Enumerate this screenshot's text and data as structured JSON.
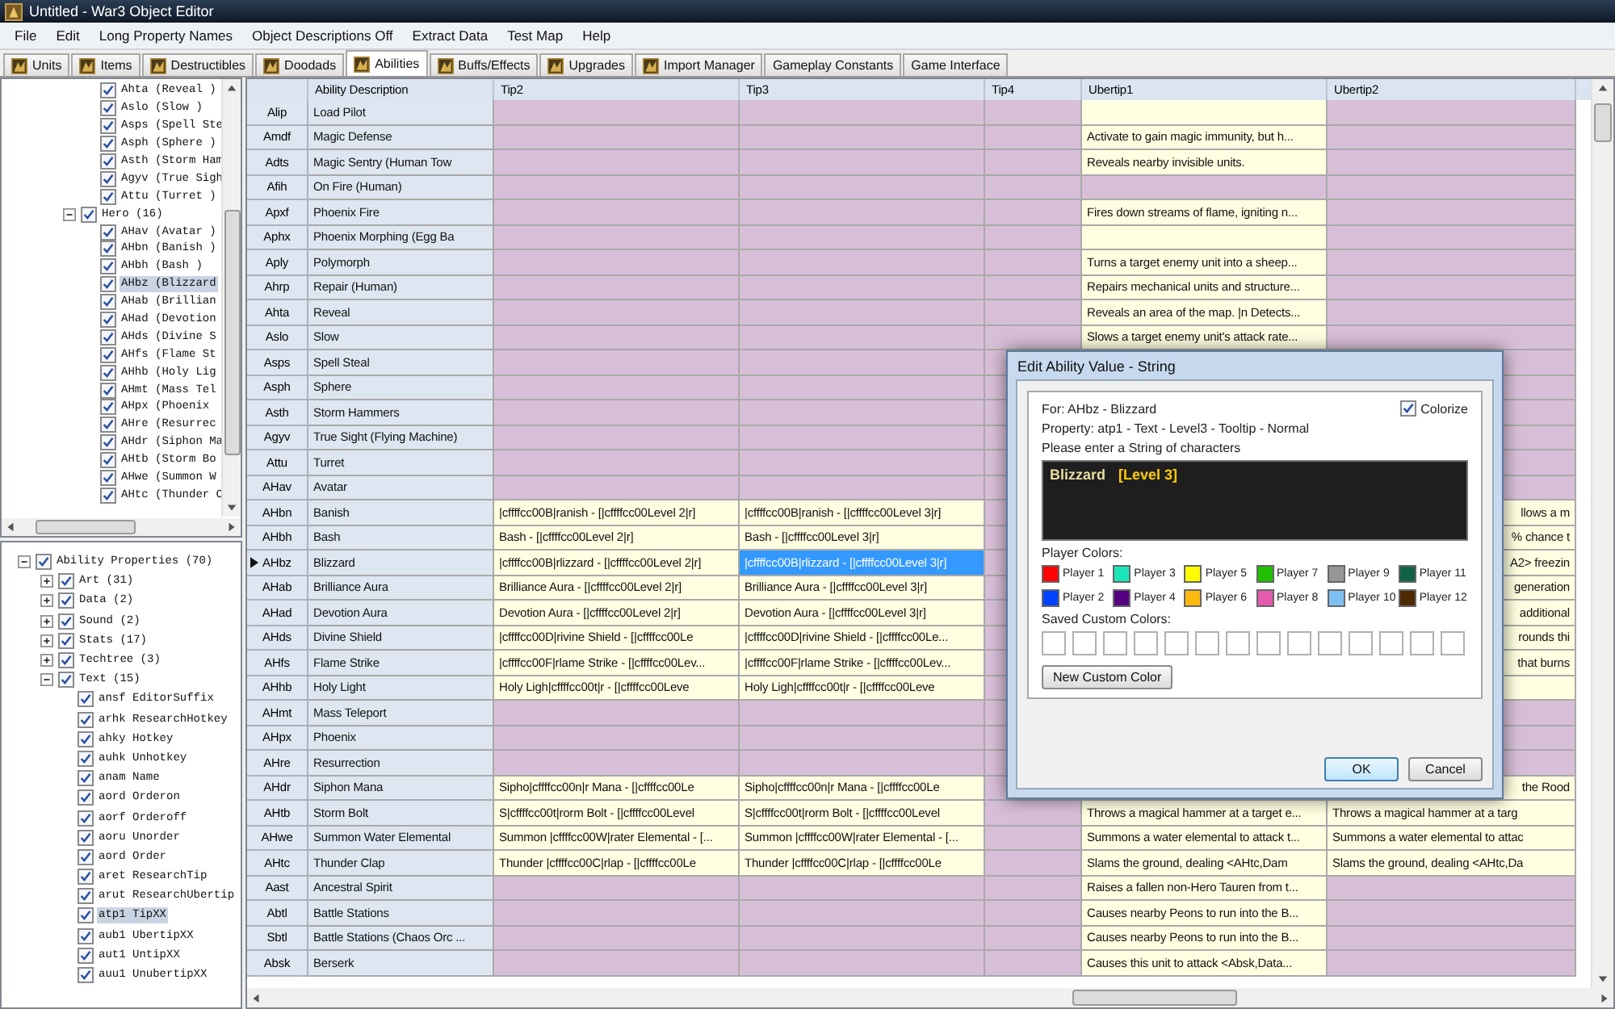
{
  "window": {
    "title": "Untitled - War3 Object Editor"
  },
  "menu": [
    "File",
    "Edit",
    "Long Property Names",
    "Object Descriptions Off",
    "Extract Data",
    "Test Map",
    "Help"
  ],
  "tabs": [
    {
      "label": "Units",
      "kind": "icon",
      "selected": false
    },
    {
      "label": "Items",
      "kind": "icon",
      "selected": false
    },
    {
      "label": "Destructibles",
      "kind": "icon",
      "selected": false
    },
    {
      "label": "Doodads",
      "kind": "icon",
      "selected": false
    },
    {
      "label": "Abilities",
      "kind": "icon",
      "selected": true
    },
    {
      "label": "Buffs/Effects",
      "kind": "icon",
      "selected": false
    },
    {
      "label": "Upgrades",
      "kind": "icon",
      "selected": false
    },
    {
      "label": "Import Manager",
      "kind": "icon",
      "selected": false
    },
    {
      "label": "Gameplay Constants",
      "kind": "plain",
      "selected": false
    },
    {
      "label": "Game Interface",
      "kind": "plain",
      "selected": false
    }
  ],
  "top_tree": {
    "continued_items": [
      {
        "label": "Ahta (Reveal )",
        "checked": true,
        "selected": false
      },
      {
        "label": "Aslo (Slow )",
        "checked": true,
        "selected": false
      },
      {
        "label": "Asps (Spell Ste",
        "checked": true,
        "selected": false
      },
      {
        "label": "Asph (Sphere )",
        "checked": true,
        "selected": false
      },
      {
        "label": "Asth (Storm Ham",
        "checked": true,
        "selected": false
      },
      {
        "label": "Agyv (True Sigh",
        "checked": true,
        "selected": false
      },
      {
        "label": "Attu (Turret )",
        "checked": true,
        "selected": false
      }
    ],
    "groups": [
      {
        "label": "Hero (16)",
        "checked": true,
        "expanded": true,
        "selected": false,
        "children": [
          {
            "label": "AHav (Avatar )",
            "checked": true,
            "selected": false
          },
          {
            "label": "AHbn (Banish )",
            "checked": true,
            "selected": false
          },
          {
            "label": "AHbh (Bash )",
            "checked": true,
            "selected": false
          },
          {
            "label": "AHbz (Blizzard",
            "checked": true,
            "selected": true
          },
          {
            "label": "AHab (Brillian",
            "checked": true,
            "selected": false
          },
          {
            "label": "AHad (Devotion",
            "checked": true,
            "selected": false
          },
          {
            "label": "AHds (Divine S",
            "checked": true,
            "selected": false
          },
          {
            "label": "AHfs (Flame St",
            "checked": true,
            "selected": false
          },
          {
            "label": "AHhb (Holy Lig",
            "checked": true,
            "selected": false
          },
          {
            "label": "AHmt (Mass Tel",
            "checked": true,
            "selected": false
          },
          {
            "label": "AHpx (Phoenix",
            "checked": true,
            "selected": false
          },
          {
            "label": "AHre (Resurrec",
            "checked": true,
            "selected": false
          },
          {
            "label": "AHdr (Siphon Ma",
            "checked": true,
            "selected": false
          },
          {
            "label": "AHtb (Storm Bo",
            "checked": true,
            "selected": false
          },
          {
            "label": "AHwe (Summon W",
            "checked": true,
            "selected": false
          },
          {
            "label": "AHtc (Thunder C",
            "checked": true,
            "selected": false
          }
        ]
      }
    ]
  },
  "property_tree": {
    "label": "Ability Properties (70)",
    "checked": true,
    "expanded": true,
    "selected": false,
    "children": [
      {
        "label": "Art (31)",
        "checked": true,
        "expanded": false,
        "selected": false
      },
      {
        "label": "Data (2)",
        "checked": true,
        "expanded": false,
        "selected": false
      },
      {
        "label": "Sound (2)",
        "checked": true,
        "expanded": false,
        "selected": false
      },
      {
        "label": "Stats (17)",
        "checked": true,
        "expanded": false,
        "selected": false
      },
      {
        "label": "Techtree (3)",
        "checked": true,
        "expanded": false,
        "selected": false
      },
      {
        "label": "Text (15)",
        "checked": true,
        "expanded": true,
        "selected": false,
        "children": [
          {
            "label": "ansf EditorSuffix",
            "checked": true,
            "selected": false
          },
          {
            "label": "arhk ResearchHotkey",
            "checked": true,
            "selected": false
          },
          {
            "label": "ahky Hotkey",
            "checked": true,
            "selected": false
          },
          {
            "label": "auhk Unhotkey",
            "checked": true,
            "selected": false
          },
          {
            "label": "anam Name",
            "checked": true,
            "selected": false
          },
          {
            "label": "aord Orderon",
            "checked": true,
            "selected": false
          },
          {
            "label": "aorf Orderoff",
            "checked": true,
            "selected": false
          },
          {
            "label": "aoru Unorder",
            "checked": true,
            "selected": false
          },
          {
            "label": "aord Order",
            "checked": true,
            "selected": false
          },
          {
            "label": "aret ResearchTip",
            "checked": true,
            "selected": false
          },
          {
            "label": "arut ResearchUbertip",
            "checked": true,
            "selected": false
          },
          {
            "label": "atp1 TipXX",
            "checked": true,
            "selected": true
          },
          {
            "label": "aub1 UbertipXX",
            "checked": true,
            "selected": false
          },
          {
            "label": "aut1 UntipXX",
            "checked": true,
            "selected": false
          },
          {
            "label": "auu1 UnubertipXX",
            "checked": true,
            "selected": false
          }
        ]
      }
    ]
  },
  "table": {
    "columns": [
      "",
      "Ability Description",
      "Tip2",
      "Tip3",
      "Tip4",
      "Ubertip1",
      "Ubertip2"
    ],
    "rows": [
      {
        "current": false,
        "cells": [
          {
            "text": "Alip"
          },
          {
            "text": "Load Pilot"
          },
          {
            "filled": false,
            "selected": false
          },
          {
            "filled": false,
            "selected": false
          },
          {
            "filled": false,
            "selected": false
          },
          {
            "filled": true,
            "selected": false
          },
          {
            "filled": false,
            "selected": false
          }
        ]
      },
      {
        "current": false,
        "cells": [
          {
            "text": "Amdf"
          },
          {
            "text": "Magic Defense"
          },
          {
            "filled": false,
            "selected": false
          },
          {
            "filled": false,
            "selected": false
          },
          {
            "filled": false,
            "selected": false
          },
          {
            "filled": true,
            "selected": false,
            "text": "Activate to gain magic immunity, but h..."
          },
          {
            "filled": false,
            "selected": false
          }
        ]
      },
      {
        "current": false,
        "cells": [
          {
            "text": "Adts"
          },
          {
            "text": "Magic Sentry (Human Tow"
          },
          {
            "filled": false,
            "selected": false
          },
          {
            "filled": false,
            "selected": false
          },
          {
            "filled": false,
            "selected": false
          },
          {
            "filled": true,
            "selected": false,
            "text": "Reveals nearby invisible units."
          },
          {
            "filled": false,
            "selected": false
          }
        ]
      },
      {
        "current": false,
        "cells": [
          {
            "text": "Afih"
          },
          {
            "text": "On Fire (Human)"
          },
          {
            "filled": false,
            "selected": false
          },
          {
            "filled": false,
            "selected": false
          },
          {
            "filled": false,
            "selected": false
          },
          {
            "filled": false,
            "selected": false
          },
          {
            "filled": false,
            "selected": false
          }
        ]
      },
      {
        "current": false,
        "cells": [
          {
            "text": "Apxf"
          },
          {
            "text": "Phoenix Fire"
          },
          {
            "filled": false,
            "selected": false
          },
          {
            "filled": false,
            "selected": false
          },
          {
            "filled": false,
            "selected": false
          },
          {
            "filled": true,
            "selected": false,
            "text": "Fires down streams of flame, igniting n..."
          },
          {
            "filled": false,
            "selected": false
          }
        ]
      },
      {
        "current": false,
        "cells": [
          {
            "text": "Aphx"
          },
          {
            "text": "Phoenix Morphing (Egg Ba"
          },
          {
            "filled": false,
            "selected": false
          },
          {
            "filled": false,
            "selected": false
          },
          {
            "filled": false,
            "selected": false
          },
          {
            "filled": true,
            "selected": false
          },
          {
            "filled": false,
            "selected": false
          }
        ]
      },
      {
        "current": false,
        "cells": [
          {
            "text": "Aply"
          },
          {
            "text": "Polymorph"
          },
          {
            "filled": false,
            "selected": false
          },
          {
            "filled": false,
            "selected": false
          },
          {
            "filled": false,
            "selected": false
          },
          {
            "filled": true,
            "selected": false,
            "text": "Turns a target enemy unit into a sheep..."
          },
          {
            "filled": false,
            "selected": false
          }
        ]
      },
      {
        "current": false,
        "cells": [
          {
            "text": "Ahrp"
          },
          {
            "text": "Repair (Human)"
          },
          {
            "filled": false,
            "selected": false
          },
          {
            "filled": false,
            "selected": false
          },
          {
            "filled": false,
            "selected": false
          },
          {
            "filled": true,
            "selected": false,
            "text": "Repairs mechanical units and structure..."
          },
          {
            "filled": false,
            "selected": false
          }
        ]
      },
      {
        "current": false,
        "cells": [
          {
            "text": "Ahta"
          },
          {
            "text": "Reveal"
          },
          {
            "filled": false,
            "selected": false
          },
          {
            "filled": false,
            "selected": false
          },
          {
            "filled": false,
            "selected": false
          },
          {
            "filled": true,
            "selected": false,
            "text": "Reveals an area of the map. |n Detects..."
          },
          {
            "filled": false,
            "selected": false
          }
        ]
      },
      {
        "current": false,
        "cells": [
          {
            "text": "Aslo"
          },
          {
            "text": "Slow"
          },
          {
            "filled": false,
            "selected": false
          },
          {
            "filled": false,
            "selected": false
          },
          {
            "filled": false,
            "selected": false
          },
          {
            "filled": true,
            "selected": false,
            "text": "Slows a target enemy unit's attack rate..."
          },
          {
            "filled": false,
            "selected": false
          }
        ]
      },
      {
        "current": false,
        "cells": [
          {
            "text": "Asps"
          },
          {
            "text": "Spell Steal"
          },
          {
            "filled": false,
            "selected": false
          },
          {
            "filled": false,
            "selected": false
          },
          {
            "filled": false,
            "selected": false
          },
          {},
          {
            "filled": false,
            "selected": false
          }
        ]
      },
      {
        "current": false,
        "cells": [
          {
            "text": "Asph"
          },
          {
            "text": "Sphere"
          },
          {
            "filled": false,
            "selected": false
          },
          {
            "filled": false,
            "selected": false
          },
          {
            "filled": false,
            "selected": false
          },
          {},
          {
            "filled": false,
            "selected": false
          }
        ]
      },
      {
        "current": false,
        "cells": [
          {
            "text": "Asth"
          },
          {
            "text": "Storm Hammers"
          },
          {
            "filled": false,
            "selected": false
          },
          {
            "filled": false,
            "selected": false
          },
          {
            "filled": false,
            "selected": false
          },
          {},
          {
            "filled": false,
            "selected": false
          }
        ]
      },
      {
        "current": false,
        "cells": [
          {
            "text": "Agyv"
          },
          {
            "text": "True Sight (Flying Machine)"
          },
          {
            "filled": false,
            "selected": false
          },
          {
            "filled": false,
            "selected": false
          },
          {
            "filled": false,
            "selected": false
          },
          {},
          {
            "filled": false,
            "selected": false
          }
        ]
      },
      {
        "current": false,
        "cells": [
          {
            "text": "Attu"
          },
          {
            "text": "Turret"
          },
          {
            "filled": false,
            "selected": false
          },
          {
            "filled": false,
            "selected": false
          },
          {
            "filled": false,
            "selected": false
          },
          {},
          {
            "filled": false,
            "selected": false
          }
        ]
      },
      {
        "current": false,
        "cells": [
          {
            "text": "AHav"
          },
          {
            "text": "Avatar"
          },
          {
            "filled": false,
            "selected": false
          },
          {
            "filled": false,
            "selected": false
          },
          {
            "filled": false,
            "selected": false
          },
          {},
          {
            "filled": false,
            "selected": false
          }
        ]
      },
      {
        "current": false,
        "cells": [
          {
            "text": "AHbn"
          },
          {
            "text": "Banish"
          },
          {
            "filled": true,
            "selected": false,
            "text": "|cffffcc00B|ranish - [|cffffcc00Level 2|r]"
          },
          {
            "filled": true,
            "selected": false,
            "text": "|cffffcc00B|ranish - [|cffffcc00Level 3|r]"
          },
          {
            "filled": false,
            "selected": false
          },
          {},
          {
            "filled": true,
            "selected": false,
            "clipped": true,
            "text": "llows a m"
          }
        ]
      },
      {
        "current": false,
        "cells": [
          {
            "text": "AHbh"
          },
          {
            "text": "Bash"
          },
          {
            "filled": true,
            "selected": false,
            "text": "Bash - [|cffffcc00Level 2|r]"
          },
          {
            "filled": true,
            "selected": false,
            "text": "Bash - [|cffffcc00Level 3|r]"
          },
          {
            "filled": false,
            "selected": false
          },
          {},
          {
            "filled": true,
            "selected": false,
            "clipped": true,
            "text": "% chance t"
          }
        ]
      },
      {
        "current": true,
        "cells": [
          {
            "text": "AHbz"
          },
          {
            "text": "Blizzard"
          },
          {
            "filled": true,
            "selected": false,
            "text": "|cffffcc00B|rlizzard - [|cffffcc00Level 2|r]"
          },
          {
            "filled": true,
            "selected": true,
            "text": "|cffffcc00B|rlizzard - [|cffffcc00Level 3|r]"
          },
          {
            "filled": false,
            "selected": false
          },
          {},
          {
            "filled": true,
            "selected": false,
            "clipped": true,
            "text": "A2> freezin"
          }
        ]
      },
      {
        "current": false,
        "cells": [
          {
            "text": "AHab"
          },
          {
            "text": "Brilliance Aura"
          },
          {
            "filled": true,
            "selected": false,
            "text": "Brilliance Aura - [|cffffcc00Level 2|r]"
          },
          {
            "filled": true,
            "selected": false,
            "text": "Brilliance Aura - [|cffffcc00Level 3|r]"
          },
          {
            "filled": false,
            "selected": false
          },
          {},
          {
            "filled": true,
            "selected": false,
            "clipped": true,
            "text": "generation"
          }
        ]
      },
      {
        "current": false,
        "cells": [
          {
            "text": "AHad"
          },
          {
            "text": "Devotion Aura"
          },
          {
            "filled": true,
            "selected": false,
            "text": "Devotion Aura - [|cffffcc00Level 2|r]"
          },
          {
            "filled": true,
            "selected": false,
            "text": "Devotion Aura - [|cffffcc00Level 3|r]"
          },
          {
            "filled": false,
            "selected": false
          },
          {},
          {
            "filled": true,
            "selected": false,
            "clipped": true,
            "text": "additional"
          }
        ]
      },
      {
        "current": false,
        "cells": [
          {
            "text": "AHds"
          },
          {
            "text": "Divine Shield"
          },
          {
            "filled": true,
            "selected": false,
            "text": "|cffffcc00D|rivine Shield - [|cffffcc00Le"
          },
          {
            "filled": true,
            "selected": false,
            "text": "|cffffcc00D|rivine Shield - [|cffffcc00Le..."
          },
          {
            "filled": false,
            "selected": false
          },
          {},
          {
            "filled": true,
            "selected": false,
            "clipped": true,
            "text": "rounds thi"
          }
        ]
      },
      {
        "current": false,
        "cells": [
          {
            "text": "AHfs"
          },
          {
            "text": "Flame Strike"
          },
          {
            "filled": true,
            "selected": false,
            "text": "|cffffcc00F|rlame Strike - [|cffffcc00Lev..."
          },
          {
            "filled": true,
            "selected": false,
            "text": "|cffffcc00F|rlame Strike - [|cffffcc00Lev..."
          },
          {
            "filled": false,
            "selected": false
          },
          {},
          {
            "filled": true,
            "selected": false,
            "clipped": true,
            "text": "that burns"
          }
        ]
      },
      {
        "current": false,
        "cells": [
          {
            "text": "AHhb"
          },
          {
            "text": "Holy Light"
          },
          {
            "filled": true,
            "selected": false,
            "text": "Holy Ligh|cffffcc00t|r - [|cffffcc00Leve"
          },
          {
            "filled": true,
            "selected": false,
            "text": "Holy Ligh|cffffcc00t|r - [|cffffcc00Leve"
          },
          {
            "filled": false,
            "selected": false
          },
          {},
          {
            "filled": true,
            "selected": false
          }
        ]
      },
      {
        "current": false,
        "cells": [
          {
            "text": "AHmt"
          },
          {
            "text": "Mass Teleport"
          },
          {
            "filled": false,
            "selected": false
          },
          {
            "filled": false,
            "selected": false
          },
          {
            "filled": false,
            "selected": false
          },
          {},
          {
            "filled": false,
            "selected": false
          }
        ]
      },
      {
        "current": false,
        "cells": [
          {
            "text": "AHpx"
          },
          {
            "text": "Phoenix"
          },
          {
            "filled": false,
            "selected": false
          },
          {
            "filled": false,
            "selected": false
          },
          {
            "filled": false,
            "selected": false
          },
          {},
          {
            "filled": false,
            "selected": false
          }
        ]
      },
      {
        "current": false,
        "cells": [
          {
            "text": "AHre"
          },
          {
            "text": "Resurrection"
          },
          {
            "filled": false,
            "selected": false
          },
          {
            "filled": false,
            "selected": false
          },
          {
            "filled": false,
            "selected": false
          },
          {},
          {
            "filled": false,
            "selected": false
          }
        ]
      },
      {
        "current": false,
        "cells": [
          {
            "text": "AHdr"
          },
          {
            "text": "Siphon Mana"
          },
          {
            "filled": true,
            "selected": false,
            "text": "Sipho|cffffcc00n|r Mana - [|cffffcc00Le"
          },
          {
            "filled": true,
            "selected": false,
            "text": "Sipho|cffffcc00n|r Mana - [|cffffcc00Le"
          },
          {
            "filled": false,
            "selected": false
          },
          {},
          {
            "filled": true,
            "selected": false,
            "clipped": true,
            "text": "the Rood"
          }
        ]
      },
      {
        "current": false,
        "cells": [
          {
            "text": "AHtb"
          },
          {
            "text": "Storm Bolt"
          },
          {
            "filled": true,
            "selected": false,
            "text": "S|cffffcc00t|rorm Bolt - [|cffffcc00Level"
          },
          {
            "filled": true,
            "selected": false,
            "text": "S|cffffcc00t|rorm Bolt - [|cffffcc00Level"
          },
          {
            "filled": false,
            "selected": false
          },
          {
            "filled": true,
            "selected": false,
            "text": "Throws a magical hammer at a target e..."
          },
          {
            "filled": true,
            "selected": false,
            "text": "Throws a magical hammer at a targ"
          }
        ]
      },
      {
        "current": false,
        "cells": [
          {
            "text": "AHwe"
          },
          {
            "text": "Summon Water Elemental"
          },
          {
            "filled": true,
            "selected": false,
            "text": "Summon |cffffcc00W|rater Elemental - [..."
          },
          {
            "filled": true,
            "selected": false,
            "text": "Summon |cffffcc00W|rater Elemental - [..."
          },
          {
            "filled": false,
            "selected": false
          },
          {
            "filled": true,
            "selected": false,
            "text": "Summons a water elemental to attack t..."
          },
          {
            "filled": true,
            "selected": false,
            "text": "Summons a water elemental to attac"
          }
        ]
      },
      {
        "current": false,
        "cells": [
          {
            "text": "AHtc"
          },
          {
            "text": "Thunder Clap"
          },
          {
            "filled": true,
            "selected": false,
            "text": "Thunder |cffffcc00C|rlap - [|cffffcc00Le"
          },
          {
            "filled": true,
            "selected": false,
            "text": "Thunder |cffffcc00C|rlap - [|cffffcc00Le"
          },
          {
            "filled": false,
            "selected": false
          },
          {
            "filled": true,
            "selected": false,
            "text": "Slams the ground, dealing <AHtc,Dam"
          },
          {
            "filled": true,
            "selected": false,
            "text": "Slams the ground, dealing <AHtc,Da"
          }
        ]
      },
      {
        "current": false,
        "cells": [
          {
            "text": "Aast"
          },
          {
            "text": "Ancestral Spirit"
          },
          {
            "filled": false,
            "selected": false
          },
          {
            "filled": false,
            "selected": false
          },
          {
            "filled": false,
            "selected": false
          },
          {
            "filled": true,
            "selected": false,
            "text": "Raises a fallen non-Hero Tauren from t..."
          },
          {
            "filled": false,
            "selected": false
          }
        ]
      },
      {
        "current": false,
        "cells": [
          {
            "text": "Abtl"
          },
          {
            "text": "Battle Stations"
          },
          {
            "filled": false,
            "selected": false
          },
          {
            "filled": false,
            "selected": false
          },
          {
            "filled": false,
            "selected": false
          },
          {
            "filled": true,
            "selected": false,
            "text": "Causes nearby Peons to run into the B..."
          },
          {
            "filled": false,
            "selected": false
          }
        ]
      },
      {
        "current": false,
        "cells": [
          {
            "text": "Sbtl"
          },
          {
            "text": "Battle Stations (Chaos Orc ..."
          },
          {
            "filled": false,
            "selected": false
          },
          {
            "filled": false,
            "selected": false
          },
          {
            "filled": false,
            "selected": false
          },
          {
            "filled": true,
            "selected": false,
            "text": "Causes nearby Peons to run into the B..."
          },
          {
            "filled": false,
            "selected": false
          }
        ]
      },
      {
        "current": false,
        "cells": [
          {
            "text": "Absk"
          },
          {
            "text": "Berserk"
          },
          {
            "filled": false,
            "selected": false
          },
          {
            "filled": false,
            "selected": false
          },
          {
            "filled": false,
            "selected": false
          },
          {
            "filled": true,
            "selected": false,
            "text": "Causes this unit to attack <Absk,Data..."
          },
          {
            "filled": false,
            "selected": false
          }
        ]
      }
    ]
  },
  "dialog": {
    "title": "Edit Ability Value - String",
    "info": [
      "For: AHbz - Blizzard",
      "Property: atp1 - Text - Level3 - Tooltip - Normal",
      "Please enter a String of characters"
    ],
    "colorize": {
      "label": "Colorize",
      "checked": true
    },
    "value_segments": [
      {
        "text": "Blizzard",
        "color": "#e8dca0"
      },
      {
        "text": "[Level 3]",
        "color": "#ffcc00"
      }
    ],
    "player_colors_label": "Player Colors:",
    "player_colors": [
      {
        "label": "Player 1",
        "color": "#ff0303"
      },
      {
        "label": "Player 3",
        "color": "#1ce6b9"
      },
      {
        "label": "Player 5",
        "color": "#fffc01"
      },
      {
        "label": "Player 7",
        "color": "#20c000"
      },
      {
        "label": "Player 9",
        "color": "#959697"
      },
      {
        "label": "Player 11",
        "color": "#106246"
      },
      {
        "label": "Player 2",
        "color": "#0042ff"
      },
      {
        "label": "Player 4",
        "color": "#540081"
      },
      {
        "label": "Player 6",
        "color": "#feba0e"
      },
      {
        "label": "Player 8",
        "color": "#e55bb0"
      },
      {
        "label": "Player 10",
        "color": "#7ebff1"
      },
      {
        "label": "Player 12",
        "color": "#4e2a04"
      }
    ],
    "custom_colors_label": "Saved Custom Colors:",
    "custom_button": "New Custom Color",
    "buttons": [
      {
        "label": "OK",
        "default": true
      },
      {
        "label": "Cancel",
        "default": false
      }
    ]
  }
}
